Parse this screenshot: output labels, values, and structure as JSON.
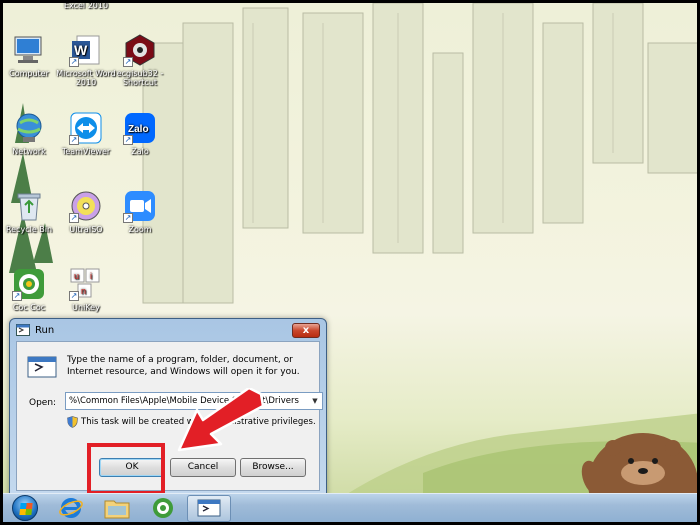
{
  "desktop": {
    "icons": [
      {
        "label": "Excel 2010",
        "icon": "excel-icon"
      },
      {
        "label": "Computer",
        "icon": "computer-icon"
      },
      {
        "label": "Microsoft Word 2010",
        "icon": "word-icon"
      },
      {
        "label": "ecgisub32 - Shortcut",
        "icon": "ecgisub-icon"
      },
      {
        "label": "Network",
        "icon": "network-icon"
      },
      {
        "label": "TeamViewer",
        "icon": "teamviewer-icon"
      },
      {
        "label": "Zalo",
        "icon": "zalo-icon"
      },
      {
        "label": "Recycle Bin",
        "icon": "recycle-bin-icon"
      },
      {
        "label": "UltraISO",
        "icon": "ultraiso-icon"
      },
      {
        "label": "Zoom",
        "icon": "zoom-icon"
      },
      {
        "label": "Coc Coc",
        "icon": "coccoc-icon"
      },
      {
        "label": "UniKey",
        "icon": "unikey-icon"
      }
    ],
    "unikey_letters": [
      "u",
      "i",
      "n"
    ]
  },
  "run_dialog": {
    "title": "Run",
    "close_glyph": "x",
    "description": "Type the name of a program, folder, document, or Internet resource, and Windows will open it for you.",
    "open_label": "Open:",
    "open_value": "%\\Common Files\\Apple\\Mobile Device Support\\Drivers",
    "dropdown_glyph": "▼",
    "admin_note": "This task will be created with administrative privileges.",
    "buttons": {
      "ok": "OK",
      "cancel": "Cancel",
      "browse": "Browse..."
    }
  },
  "taskbar": {
    "items": [
      "start-button",
      "internet-explorer-icon",
      "file-explorer-icon",
      "coccoc-icon",
      "run-window-icon"
    ],
    "active": "run-window-icon"
  },
  "colors": {
    "highlight": "#e21f26",
    "title_bar": "#a9c6e4",
    "close_button": "#c9472c"
  }
}
